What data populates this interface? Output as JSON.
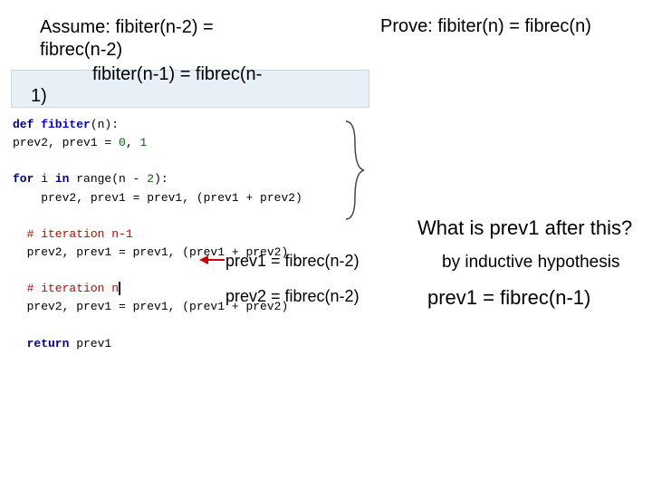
{
  "assume": {
    "line1": "Assume: fibiter(n-2) =",
    "line2": "fibrec(n-2)"
  },
  "prove": "Prove: fibiter(n) = fibrec(n)",
  "hyp2": {
    "part1": "fibiter(n-1) = fibrec(n-",
    "part2": "1)"
  },
  "code": {
    "l1": {
      "a": "def",
      "b": " fibiter",
      "c": "(n):"
    },
    "l2": {
      "a": "  prev2, prev1 = ",
      "b": "0",
      "c": ", ",
      "d": "1"
    },
    "l4": {
      "a": "  for",
      "b": " i ",
      "c": "in",
      "d": " range(n - ",
      "e": "2",
      "f": "):"
    },
    "l5": "    prev2, prev1 = prev1, (prev1 + prev2)",
    "l7": "  # iteration n-1",
    "l8": "  prev2, prev1 = prev1, (prev1 + prev2)",
    "l10a": "  # iteration n",
    "l11": "  prev2, prev1 = prev1, (prev1 + prev2)",
    "l13": {
      "a": "  return",
      "b": " prev1"
    }
  },
  "annotations": {
    "prev1": "prev1 = fibrec(n-2)",
    "prev2": "prev2 = fibrec(n-2)"
  },
  "question": "What is prev1 after this?",
  "byind": "by inductive hypothesis",
  "result": "prev1 = fibrec(n-1)"
}
